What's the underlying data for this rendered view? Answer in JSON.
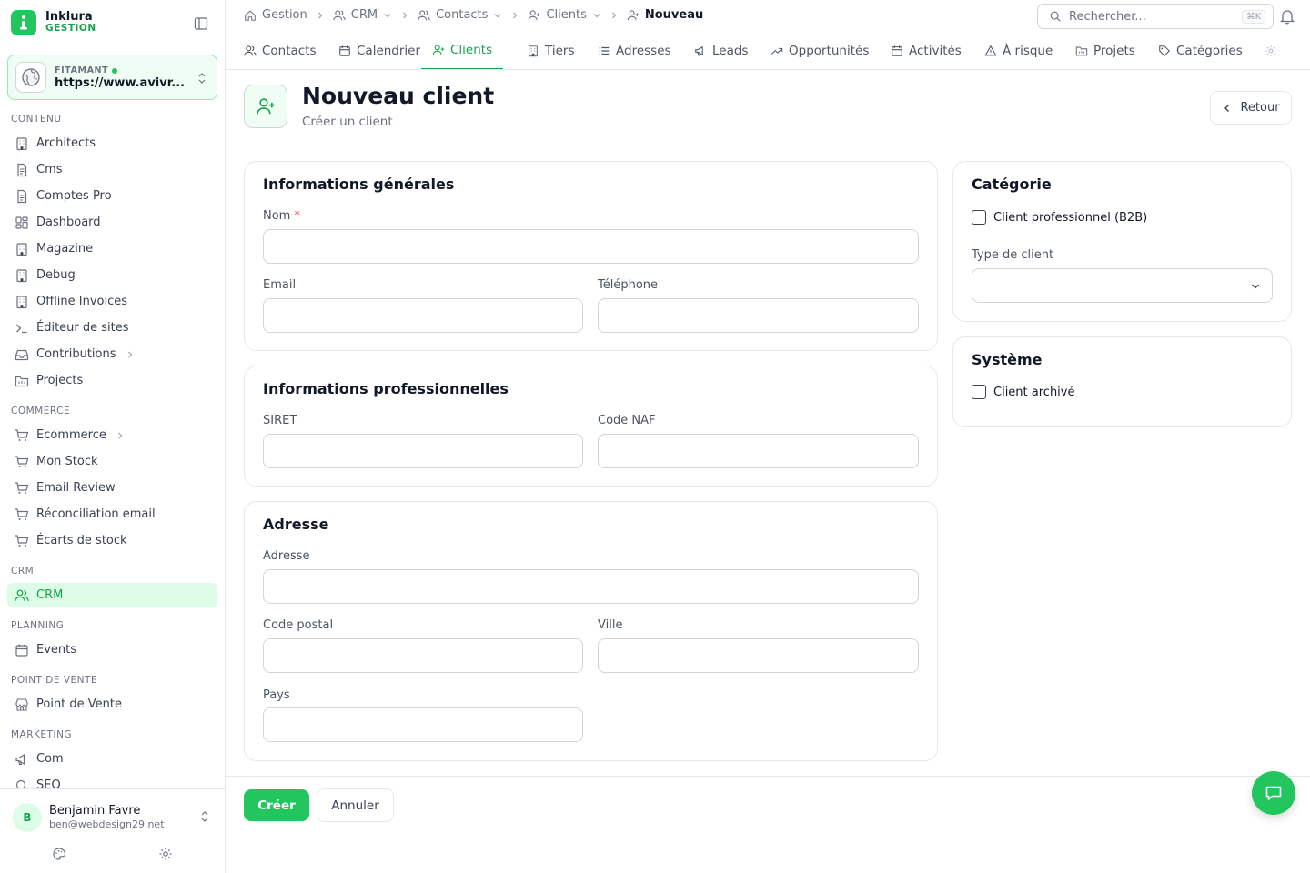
{
  "brand": {
    "name": "Inklura",
    "subtitle": "GESTION"
  },
  "site_selector": {
    "name": "FITAMANT",
    "url": "https://www.avivr..."
  },
  "nav": {
    "sections": {
      "contenu": "CONTENU",
      "commerce": "COMMERCE",
      "crm": "CRM",
      "planning": "PLANNING",
      "pos": "POINT DE VENTE",
      "marketing": "MARKETING"
    },
    "items": {
      "architects": "Architects",
      "cms": "Cms",
      "comptes_pro": "Comptes Pro",
      "dashboard": "Dashboard",
      "magazine": "Magazine",
      "debug": "Debug",
      "offline_invoices": "Offline Invoices",
      "editeur": "Éditeur de sites",
      "contributions": "Contributions",
      "projects": "Projects",
      "ecommerce": "Ecommerce",
      "mon_stock": "Mon Stock",
      "email_review": "Email Review",
      "reconciliation": "Réconciliation email",
      "ecarts": "Écarts de stock",
      "crm": "CRM",
      "events": "Events",
      "point_de_vente": "Point de Vente",
      "com": "Com",
      "seo": "SEO"
    }
  },
  "user": {
    "initial": "B",
    "name": "Benjamin Favre",
    "email": "ben@webdesign29.net"
  },
  "breadcrumb": {
    "gestion": "Gestion",
    "crm": "CRM",
    "contacts": "Contacts",
    "clients": "Clients",
    "current": "Nouveau"
  },
  "search": {
    "placeholder": "Rechercher...",
    "shortcut": "⌘K"
  },
  "tabs": {
    "contacts": "Contacts",
    "calendrier": "Calendrier",
    "clients": "Clients",
    "tiers": "Tiers",
    "adresses": "Adresses",
    "leads": "Leads",
    "opportunites": "Opportunités",
    "activites": "Activités",
    "a_risque": "À risque",
    "projets": "Projets",
    "categories": "Catégories"
  },
  "page": {
    "title": "Nouveau client",
    "subtitle": "Créer un client",
    "back_label": "Retour"
  },
  "form": {
    "general": {
      "title": "Informations générales",
      "nom_label": "Nom",
      "required_mark": "*",
      "email_label": "Email",
      "telephone_label": "Téléphone"
    },
    "pro": {
      "title": "Informations professionnelles",
      "siret_label": "SIRET",
      "naf_label": "Code NAF"
    },
    "adresse": {
      "title": "Adresse",
      "adresse_label": "Adresse",
      "cp_label": "Code postal",
      "ville_label": "Ville",
      "pays_label": "Pays"
    },
    "categorie": {
      "title": "Catégorie",
      "b2b_label": "Client professionnel (B2B)",
      "type_label": "Type de client",
      "type_value": "—"
    },
    "systeme": {
      "title": "Système",
      "archive_label": "Client archivé"
    }
  },
  "actions": {
    "create_label": "Créer",
    "cancel_label": "Annuler"
  },
  "colors": {
    "accent": "#22c55e",
    "accent_dark": "#16a34a",
    "accent_light": "#dcfce7"
  }
}
